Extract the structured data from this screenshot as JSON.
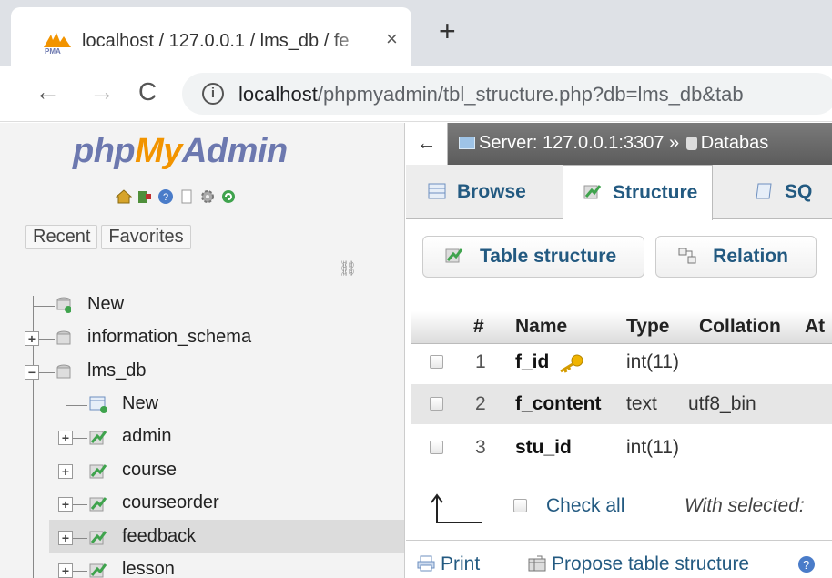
{
  "browser": {
    "tab_title": "localhost / 127.0.0.1 / lms_db / fe",
    "close_glyph": "×",
    "newtab_glyph": "+",
    "back_glyph": "←",
    "forward_glyph": "→",
    "reload_glyph": "C",
    "info_glyph": "i",
    "url_host": "localhost",
    "url_path": "/phpmyadmin/tbl_structure.php?db=lms_db&tab"
  },
  "sidebar": {
    "logo_php": "php",
    "logo_my": "My",
    "logo_admin": "Admin",
    "recent_label": "Recent",
    "favorites_label": "Favorites",
    "link_glyph": "⛓",
    "tree": {
      "new": "New",
      "information_schema": "information_schema",
      "lms_db": "lms_db",
      "lms_new": "New",
      "tables": [
        "admin",
        "course",
        "courseorder",
        "feedback",
        "lesson"
      ],
      "expander_plus": "+",
      "expander_minus": "−"
    }
  },
  "main": {
    "collapse_glyph": "←",
    "breadcrumb_server": "Server: 127.0.0.1:3307 »",
    "breadcrumb_database": "Databas",
    "tabs": {
      "browse": "Browse",
      "structure": "Structure",
      "sql": "SQ"
    },
    "subtabs": {
      "table_structure": "Table structure",
      "relation": "Relation"
    },
    "columns": {
      "num": "#",
      "name": "Name",
      "type": "Type",
      "collation": "Collation",
      "attributes": "At"
    },
    "rows": [
      {
        "num": "1",
        "name": "f_id",
        "type": "int(11)",
        "collation": "",
        "primary": true
      },
      {
        "num": "2",
        "name": "f_content",
        "type": "text",
        "collation": "utf8_bin",
        "primary": false
      },
      {
        "num": "3",
        "name": "stu_id",
        "type": "int(11)",
        "collation": "",
        "primary": false
      }
    ],
    "check_all": "Check all",
    "with_selected": "With selected:",
    "footer": {
      "print": "Print",
      "propose": "Propose table structure"
    }
  },
  "colors": {
    "accent": "#235a81",
    "logo_blue": "#6c78af",
    "logo_orange": "#f29400"
  }
}
